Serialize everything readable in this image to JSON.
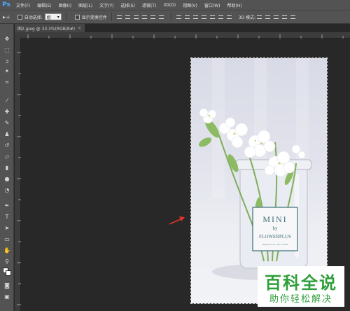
{
  "app": {
    "logo": "Ps"
  },
  "menu": [
    "文件(F)",
    "编辑(E)",
    "图像(I)",
    "图层(L)",
    "文字(Y)",
    "选择(S)",
    "滤镜(T)",
    "3D(D)",
    "视图(V)",
    "窗口(W)",
    "帮助(H)"
  ],
  "options": {
    "tool_glyph": "▸+",
    "auto_select_label": "自动选择:",
    "auto_select_value": "组",
    "show_transform_label": "显示变换控件",
    "mode_3d_label": "3D 模式:"
  },
  "document": {
    "tab_label": "图2.jpeg @ 33.3%(RGB/8#)",
    "close_glyph": "×"
  },
  "photo_text": {
    "label_top": "MINI",
    "label_mid": "by",
    "label_brand": "FLOWERPLUS",
    "label_small": "Always on our mind · florals"
  },
  "watermark": {
    "title": "百科全说",
    "subtitle": "助你轻松解决"
  },
  "colors": {
    "accent_arrow": "#e0332b",
    "watermark_green": "#2e9e3a"
  },
  "tools": [
    "move-tool-icon",
    "marquee-tool-icon",
    "lasso-tool-icon",
    "magic-wand-tool-icon",
    "crop-tool-icon",
    "eyedropper-tool-icon",
    "healing-brush-icon",
    "brush-tool-icon",
    "clone-stamp-icon",
    "history-brush-icon",
    "eraser-tool-icon",
    "gradient-tool-icon",
    "blur-tool-icon",
    "dodge-tool-icon",
    "pen-tool-icon",
    "type-tool-icon",
    "path-selection-icon",
    "shape-tool-icon",
    "hand-tool-icon",
    "zoom-tool-icon"
  ]
}
